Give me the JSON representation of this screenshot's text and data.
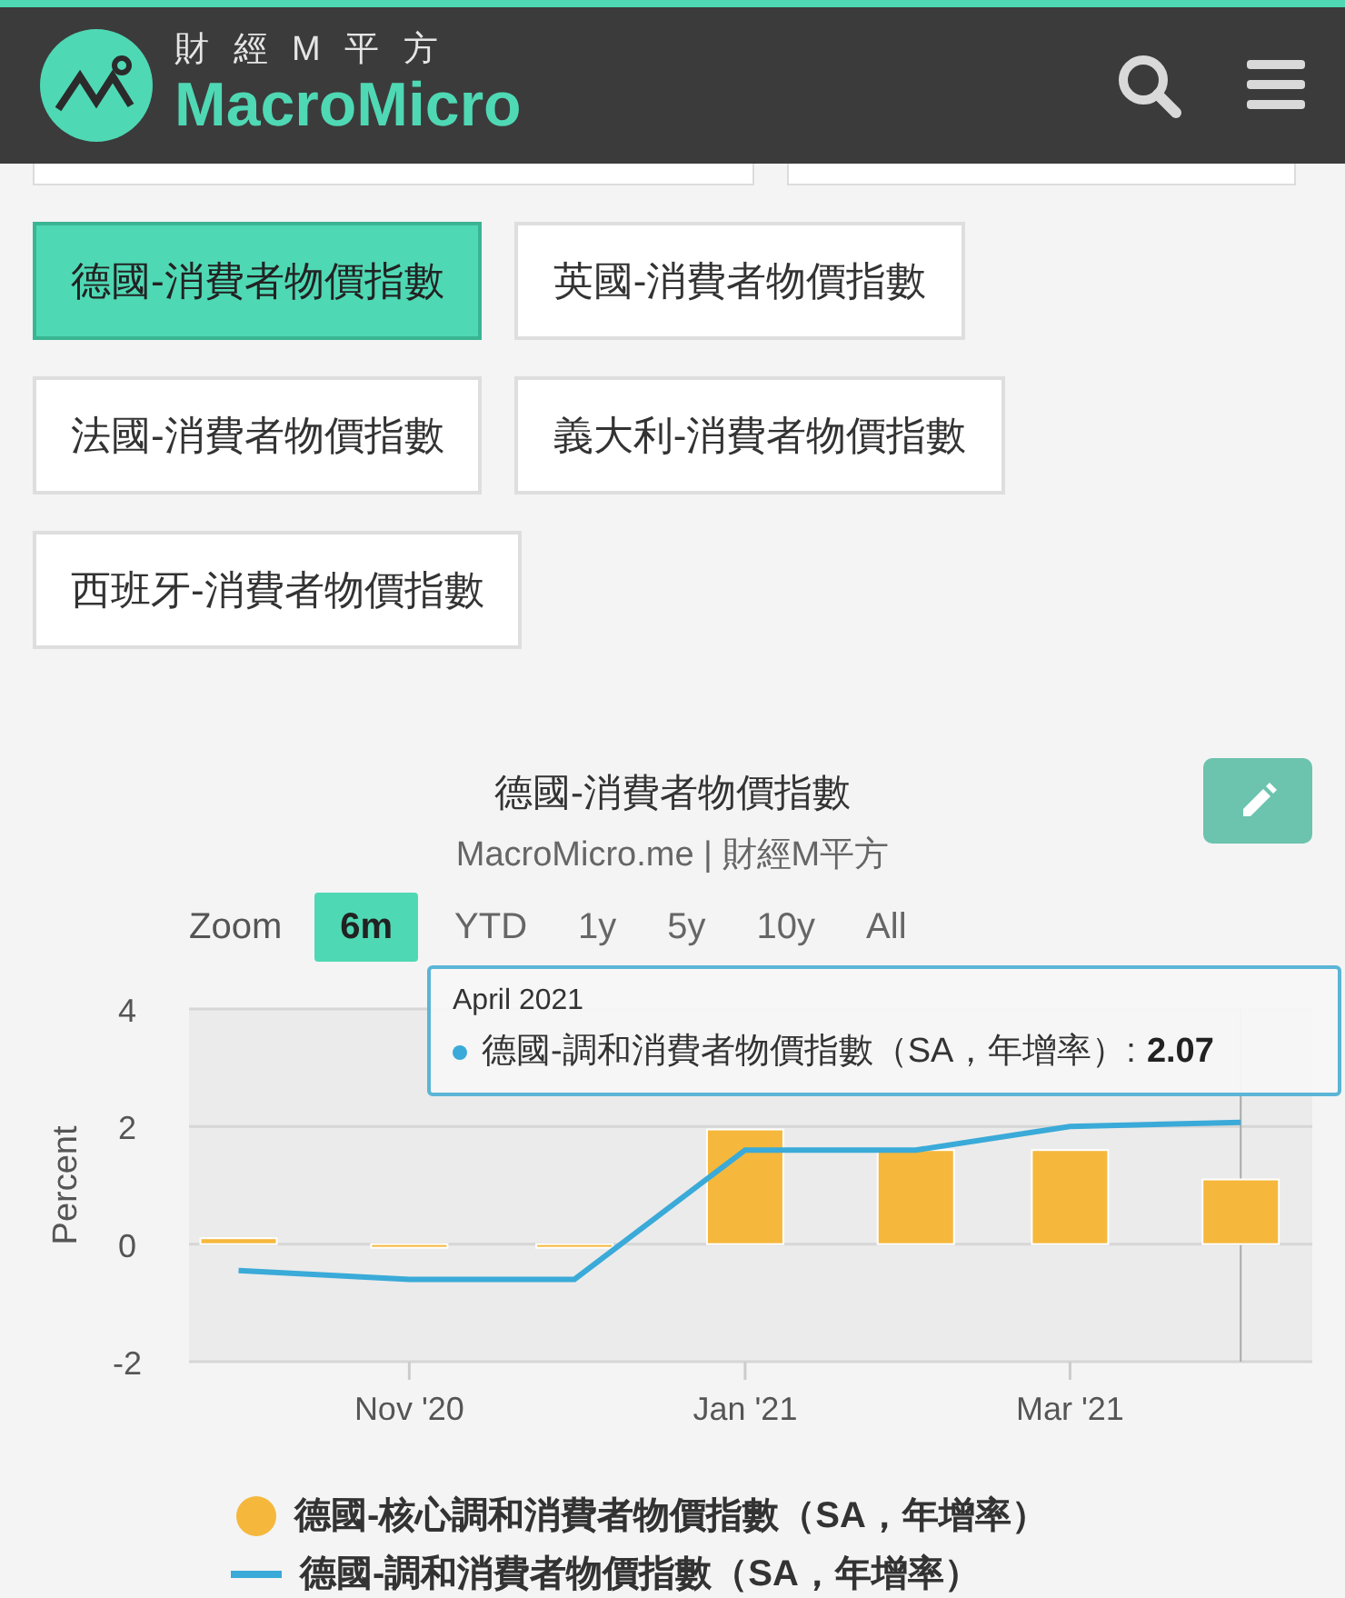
{
  "header": {
    "tagline": "財 經 M 平 方",
    "brand": "MacroMicro"
  },
  "indicator_buttons": [
    {
      "label": "德國-消費者物價指數",
      "selected": true
    },
    {
      "label": "英國-消費者物價指數",
      "selected": false
    },
    {
      "label": "法國-消費者物價指數",
      "selected": false
    },
    {
      "label": "義大利-消費者物價指數",
      "selected": false
    },
    {
      "label": "西班牙-消費者物價指數",
      "selected": false
    }
  ],
  "chart": {
    "title": "德國-消費者物價指數",
    "subtitle": "MacroMicro.me | 財經M平方",
    "zoom_label": "Zoom",
    "zoom_options": [
      {
        "label": "6m",
        "selected": true
      },
      {
        "label": "YTD",
        "selected": false
      },
      {
        "label": "1y",
        "selected": false
      },
      {
        "label": "5y",
        "selected": false
      },
      {
        "label": "10y",
        "selected": false
      },
      {
        "label": "All",
        "selected": false
      }
    ],
    "tooltip": {
      "date": "April 2021",
      "series": "德國-調和消費者物價指數（SA，年增率）:",
      "value": "2.07"
    },
    "chart_data": {
      "type": "bar",
      "ylabel": "Percent",
      "x": [
        "2020-10",
        "2020-11",
        "2020-12",
        "2021-01",
        "2021-02",
        "2021-03",
        "2021-04"
      ],
      "series": [
        {
          "name": "德國-核心調和消費者物價指數（SA，年增率）",
          "type": "bar",
          "color": "#f5b83d",
          "values": [
            0.1,
            -0.05,
            -0.05,
            1.95,
            1.6,
            1.6,
            1.1
          ]
        },
        {
          "name": "德國-調和消費者物價指數（SA，年增率）",
          "type": "line",
          "color": "#3aaad8",
          "values": [
            -0.45,
            -0.6,
            -0.6,
            1.6,
            1.6,
            2.0,
            2.07
          ]
        }
      ],
      "ref_lines": [
        {
          "axis": "x",
          "value": "2021-04"
        }
      ],
      "xlim": [
        "2020-09-22",
        "2021-04-14"
      ],
      "ylim": [
        -2,
        4
      ],
      "yticks": [
        {
          "value": -2,
          "label": "-2"
        },
        {
          "value": 0,
          "label": "0"
        },
        {
          "value": 2,
          "label": "2"
        },
        {
          "value": 4,
          "label": "4"
        }
      ],
      "xticks": [
        {
          "value": "2020-11",
          "label": "Nov '20"
        },
        {
          "value": "2021-01",
          "label": "Jan '21"
        },
        {
          "value": "2021-03",
          "label": "Mar '21"
        }
      ]
    }
  }
}
